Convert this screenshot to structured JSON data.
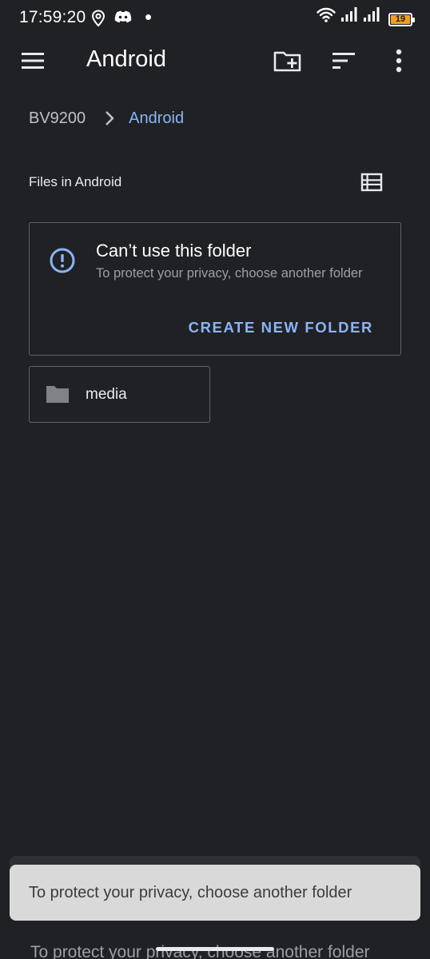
{
  "status_bar": {
    "time": "17:59:20",
    "battery_level": "19",
    "battery_color": "#f0a020"
  },
  "app_bar": {
    "title": "Android",
    "icons": [
      "menu-icon",
      "create-folder-icon",
      "sort-icon",
      "more-vert-icon"
    ]
  },
  "breadcrumb": {
    "root": "BV9200",
    "current": "Android"
  },
  "section": {
    "title": "Files in Android"
  },
  "warning": {
    "title": "Can’t use this folder",
    "description": "To protect your privacy, choose another folder",
    "action_label": "CREATE NEW FOLDER"
  },
  "folders": [
    {
      "name": "media"
    }
  ],
  "toast": {
    "message": "To protect your privacy, choose another folder"
  },
  "colors": {
    "background": "#202124",
    "accent": "#8ab4f8",
    "border": "#5f6368"
  }
}
